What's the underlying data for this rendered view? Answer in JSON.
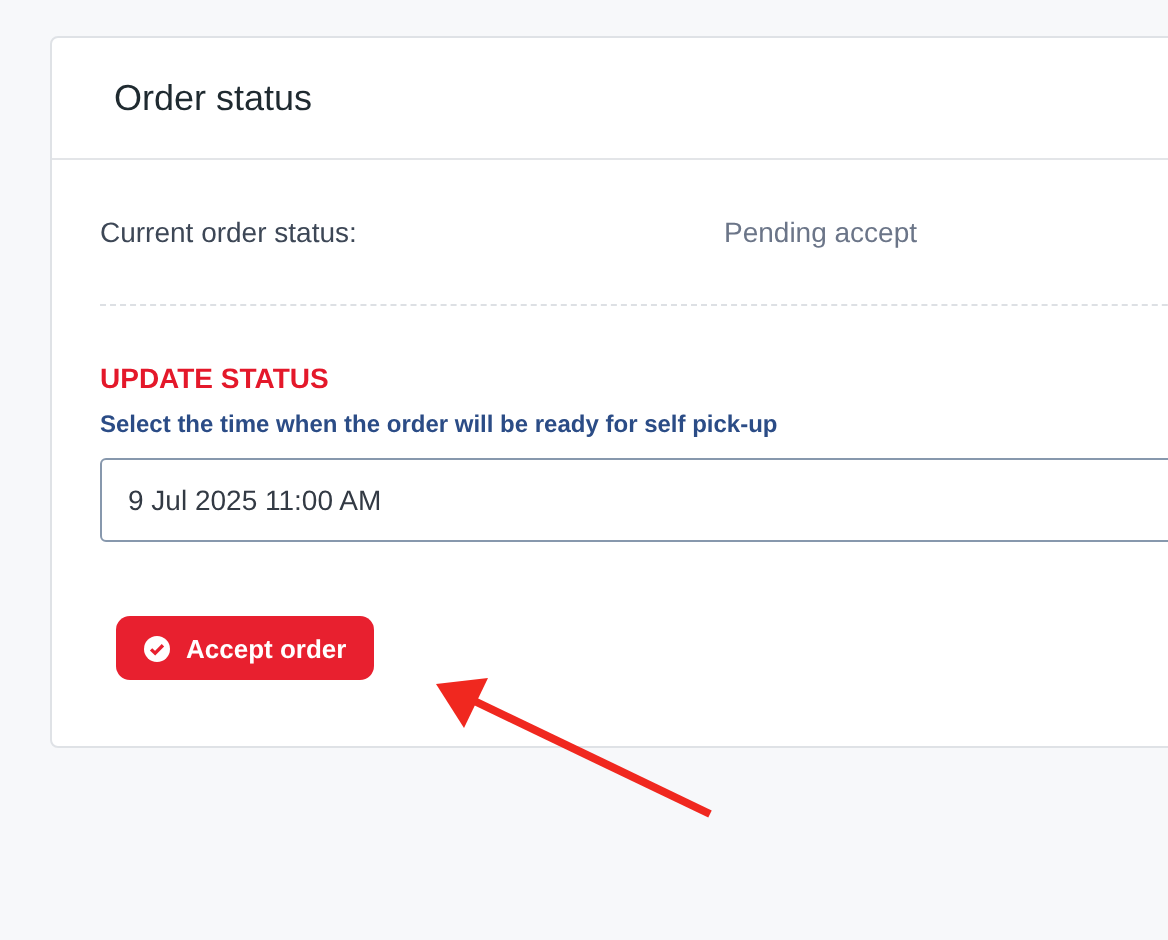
{
  "card": {
    "title": "Order status"
  },
  "current_status": {
    "label": "Current order status:",
    "value": "Pending accept"
  },
  "update": {
    "heading": "UPDATE STATUS",
    "hint": "Select the time when the order will be ready for self pick-up",
    "time_field": {
      "value": "9 Jul 2025 11:00 AM"
    },
    "button": {
      "label": "Accept order"
    }
  }
}
